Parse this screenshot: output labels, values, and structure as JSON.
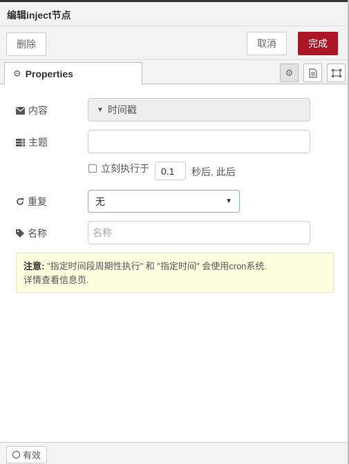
{
  "dialog": {
    "title": "编辑inject节点"
  },
  "toolbar": {
    "delete_label": "删除",
    "cancel_label": "取消",
    "done_label": "完成"
  },
  "tabs": {
    "properties_label": "Properties"
  },
  "form": {
    "payload_label": "内容",
    "payload_value": "时间戳",
    "topic_label": "主题",
    "topic_value": "",
    "inject_once_label": "立刻执行于",
    "inject_once_delay": "0.1",
    "inject_once_after": "秒后, 此后",
    "repeat_label": "重复",
    "repeat_value": "无",
    "name_label": "名称",
    "name_placeholder": "名称"
  },
  "note": {
    "prefix": "注意:",
    "line1": " \"指定时间段周期性执行\" 和 \"指定时间\" 会使用cron系统.",
    "line2": "详情查看信息页."
  },
  "footer": {
    "status_label": "有效"
  },
  "colors": {
    "primary": "#ad1625",
    "note_bg": "#ffffe0",
    "select_border": "#7ab4e0"
  }
}
